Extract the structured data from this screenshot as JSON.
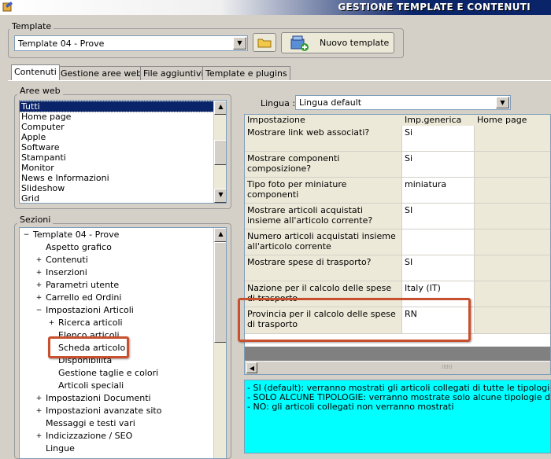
{
  "window": {
    "title": "GESTIONE TEMPLATE E CONTENUTI"
  },
  "template_section": {
    "label": "Template",
    "selected": "Template 04 - Prove",
    "folder_icon": "folder-icon",
    "new_button_label": "Nuovo template"
  },
  "tabs": [
    {
      "label": "Contenuti",
      "active": true
    },
    {
      "label": "Gestione aree web",
      "active": false
    },
    {
      "label": "File aggiuntivi",
      "active": false
    },
    {
      "label": "Template e plugins",
      "active": false
    }
  ],
  "aree_web": {
    "label": "Aree web",
    "items": [
      "Tutti",
      "Home page",
      "Computer",
      "Apple",
      "Software",
      "Stampanti",
      "Monitor",
      "News e Informazioni",
      "Slideshow",
      "Grid"
    ],
    "selected": "Tutti"
  },
  "sezioni": {
    "label": "Sezioni",
    "root": "Template 04 - Prove",
    "items": [
      {
        "label": "Aspetto grafico",
        "expander": ""
      },
      {
        "label": "Contenuti",
        "expander": "+"
      },
      {
        "label": "Inserzioni",
        "expander": "+"
      },
      {
        "label": "Parametri utente",
        "expander": "+"
      },
      {
        "label": "Carrello ed Ordini",
        "expander": "+"
      },
      {
        "label": "Impostazioni Articoli",
        "expander": "−"
      },
      {
        "label": "Ricerca articoli",
        "expander": "+"
      },
      {
        "label": "Elenco articoli",
        "expander": ""
      },
      {
        "label": "Scheda articolo",
        "expander": ""
      },
      {
        "label": "Disponibilità",
        "expander": ""
      },
      {
        "label": "Gestione taglie e colori",
        "expander": ""
      },
      {
        "label": "Articoli speciali",
        "expander": ""
      },
      {
        "label": "Impostazioni Documenti",
        "expander": "+"
      },
      {
        "label": "Impostazioni avanzate sito",
        "expander": "+"
      },
      {
        "label": "Messaggi e testi vari",
        "expander": ""
      },
      {
        "label": "Indicizzazione / SEO",
        "expander": "+"
      },
      {
        "label": "Lingue",
        "expander": ""
      }
    ]
  },
  "lingua": {
    "label": "Lingua :",
    "selected": "Lingua default"
  },
  "grid": {
    "columns": [
      "Impostazione",
      "Imp.generica",
      "Home page"
    ],
    "rows": [
      {
        "setting": "Mostrare link web associati?",
        "value": "Si"
      },
      {
        "setting": "Mostrare componenti composizione?",
        "value": "Si"
      },
      {
        "setting": "Tipo foto per miniature componenti",
        "value": "miniatura"
      },
      {
        "setting": "Mostrare articoli acquistati insieme all'articolo corrente?",
        "value": "SI"
      },
      {
        "setting": "Numero articoli acquistati insieme all'articolo corrente",
        "value": ""
      },
      {
        "setting": "Mostrare spese di trasporto?",
        "value": "SI"
      },
      {
        "setting": "Nazione per il calcolo delle spese di trasporto",
        "value": "Italy (IT)"
      },
      {
        "setting": "Provincia per il calcolo delle spese di trasporto",
        "value": "RN"
      }
    ]
  },
  "description": [
    "- SI (default): verranno mostrati gli articoli collegati di tutte le tipologie",
    "- SOLO ALCUNE TIPOLOGIE: verranno mostrate solo alcune tipologie di articoli co",
    "- NO: gli articoli collegati non verranno mostrati"
  ],
  "colors": {
    "highlight": "#c8502e",
    "description_bg": "#00ffff",
    "selection": "#0a246a"
  }
}
